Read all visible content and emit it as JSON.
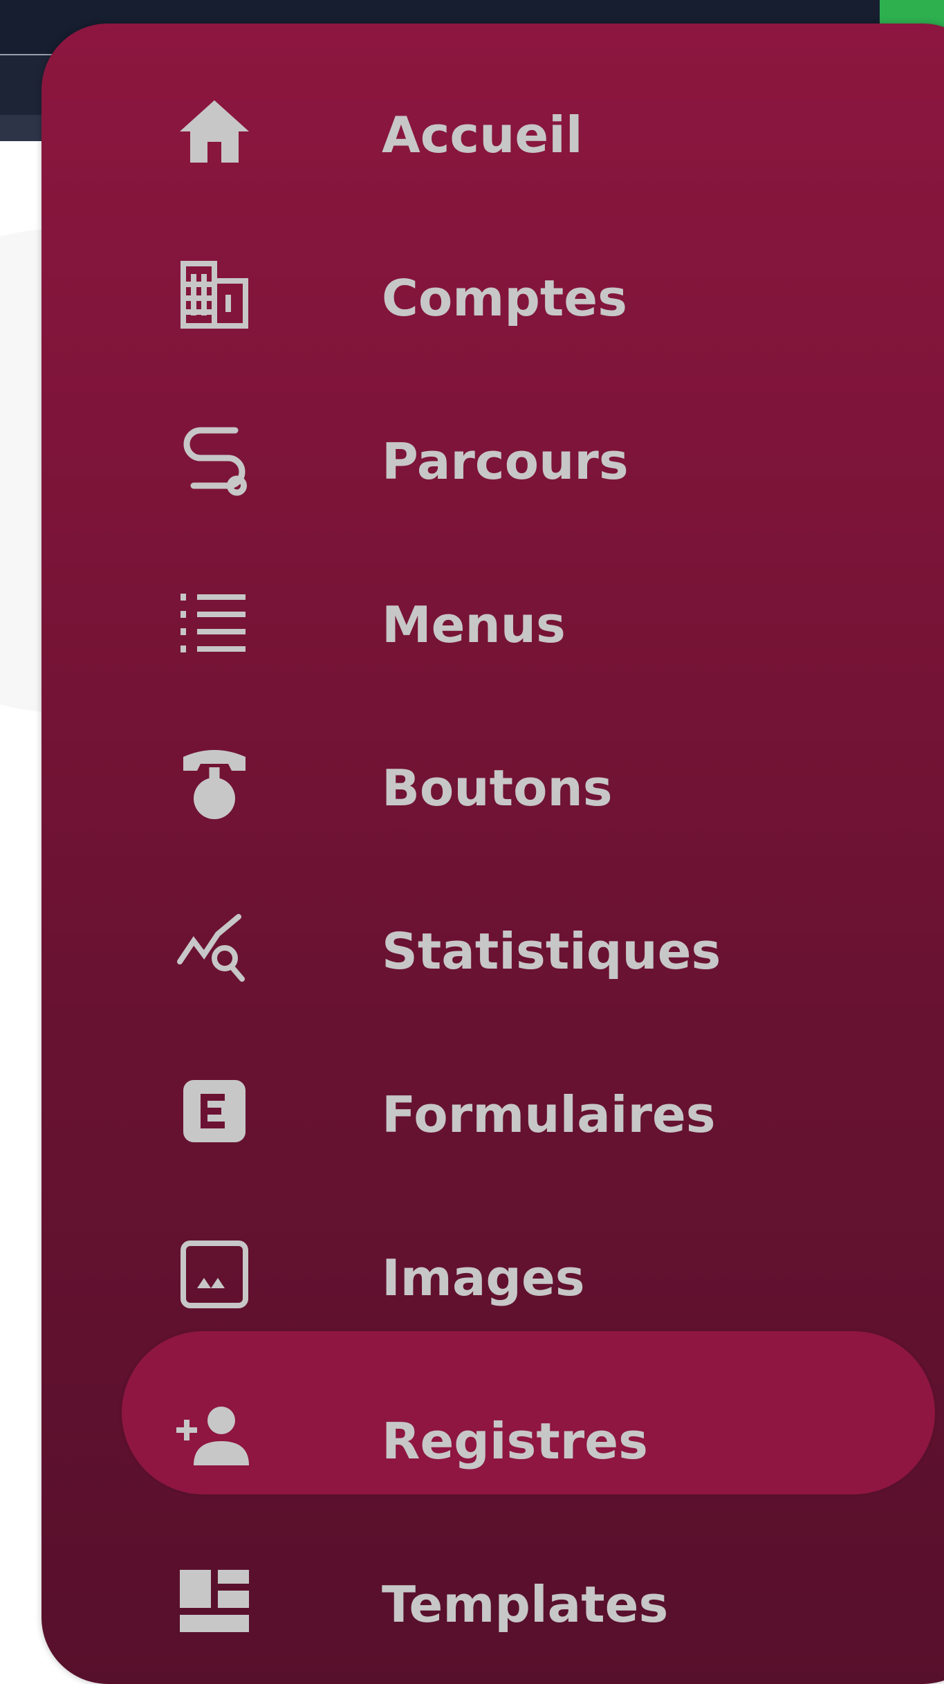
{
  "colors": {
    "sidebar_top": "#8c163f",
    "sidebar_bottom": "#57102b",
    "active_item": "#8e1641",
    "text": "#c7c7c7",
    "topbar": "#161e2f",
    "accent_green": "#2eb04f"
  },
  "sidebar": {
    "active_index": 8,
    "items": [
      {
        "label": "Accueil",
        "icon": "home-icon"
      },
      {
        "label": "Comptes",
        "icon": "building-icon"
      },
      {
        "label": "Parcours",
        "icon": "route-icon"
      },
      {
        "label": "Menus",
        "icon": "list-icon"
      },
      {
        "label": "Boutons",
        "icon": "phone-button-icon"
      },
      {
        "label": "Statistiques",
        "icon": "stats-search-icon"
      },
      {
        "label": "Formulaires",
        "icon": "form-icon"
      },
      {
        "label": "Images",
        "icon": "image-icon"
      },
      {
        "label": "Registres",
        "icon": "add-user-icon"
      },
      {
        "label": "Templates",
        "icon": "template-icon"
      }
    ]
  }
}
